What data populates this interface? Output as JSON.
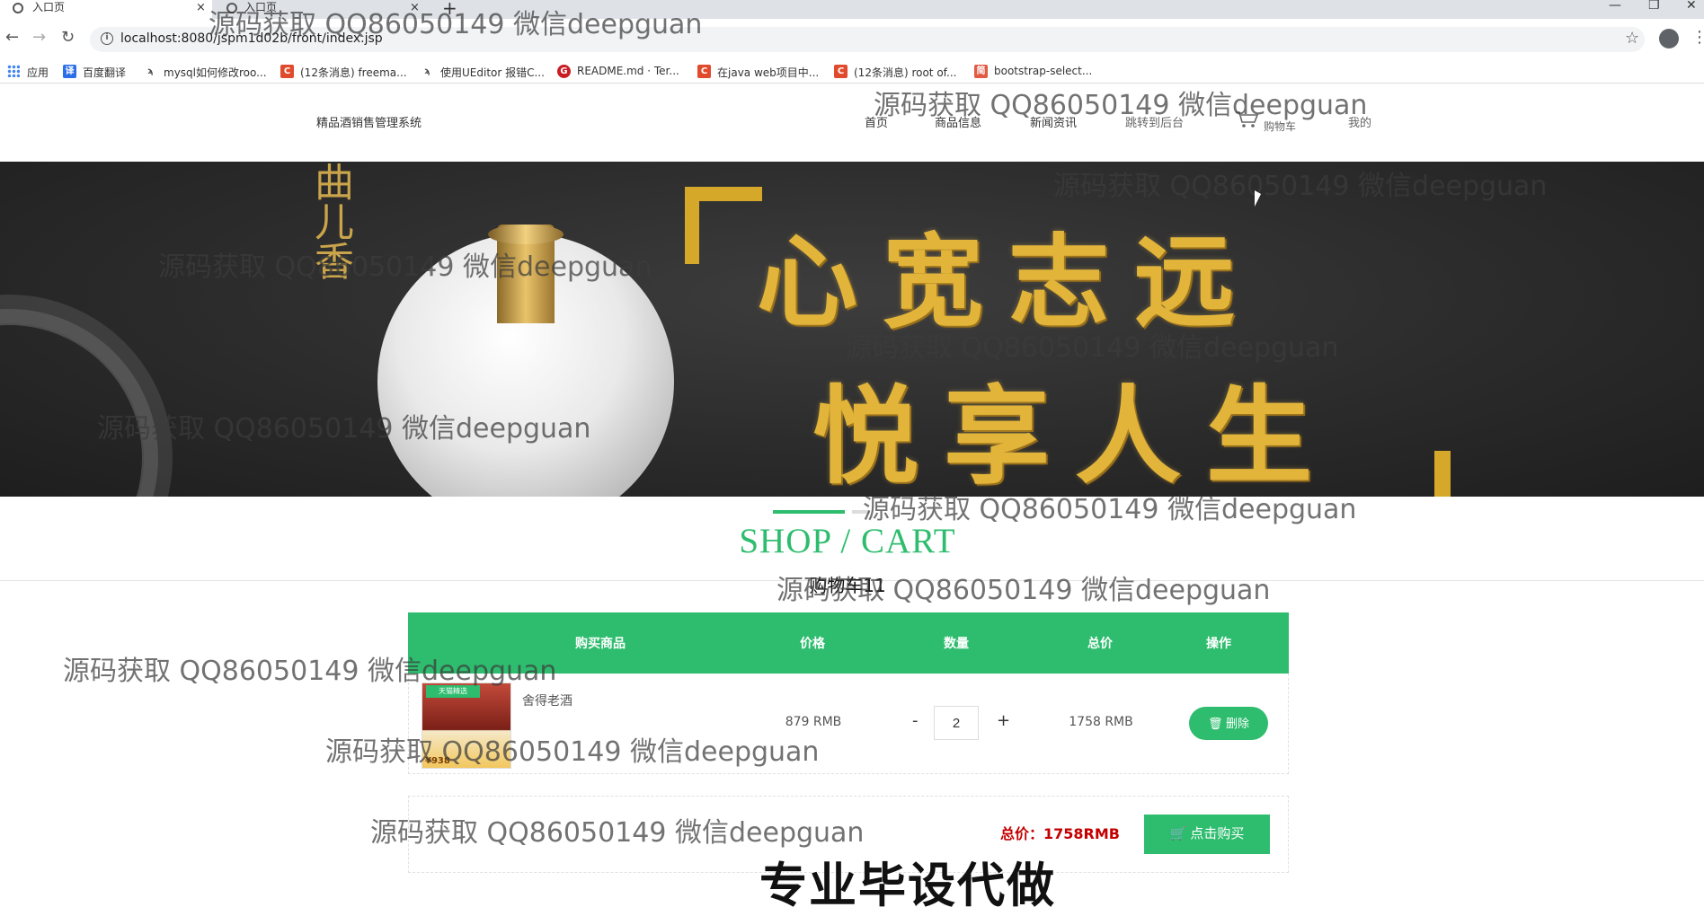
{
  "browser": {
    "tabs": [
      {
        "label": "入口页"
      },
      {
        "label": "入口页"
      }
    ],
    "tab_close": "×",
    "new_tab": "+",
    "window_controls": {
      "minimize": "—",
      "restore": "❐",
      "close": "✕"
    },
    "nav": {
      "back": "←",
      "forward": "→",
      "reload": "↻"
    },
    "url": "localhost:8080/jspm1d02b/front/index.jsp",
    "star": "☆",
    "menu": "⋮",
    "bookmarks": [
      {
        "label": "应用",
        "icon": "apps-grid-icon"
      },
      {
        "label": "百度翻译",
        "icon": "translate-icon",
        "icon_text": "译",
        "color": "#2a6ee8"
      },
      {
        "label": "mysql如何修改roo...",
        "icon": "link-icon",
        "icon_text": "ϡ",
        "color": "#444444"
      },
      {
        "label": "(12条消息) freema...",
        "icon": "csdn-icon",
        "icon_text": "C",
        "color": "#e04b2d"
      },
      {
        "label": "使用UEditor 报错C...",
        "icon": "link-icon",
        "icon_text": "ϡ",
        "color": "#444444"
      },
      {
        "label": "README.md · Ter...",
        "icon": "gitee-icon",
        "icon_text": "G",
        "color": "#c71d23"
      },
      {
        "label": "在java web项目中...",
        "icon": "csdn-icon",
        "icon_text": "C",
        "color": "#e04b2d"
      },
      {
        "label": "(12条消息) root of...",
        "icon": "csdn-icon",
        "icon_text": "C",
        "color": "#e04b2d"
      },
      {
        "label": "bootstrap-select...",
        "icon": "jianshu-icon",
        "icon_text": "简",
        "color": "#e05a44"
      }
    ]
  },
  "site": {
    "title": "精品酒销售管理系统",
    "nav": [
      {
        "label": "首页"
      },
      {
        "label": "商品信息"
      },
      {
        "label": "新闻资讯"
      },
      {
        "label": "跳转到后台"
      },
      {
        "label": "购物车"
      },
      {
        "label": "我的"
      }
    ]
  },
  "banner": {
    "brand": "曲儿香",
    "slogan_line1": "心宽志远",
    "slogan_line2": "悦享人生"
  },
  "section": {
    "title": "SHOP / CART",
    "cart_count": "购物车11"
  },
  "cart": {
    "headers": [
      "购买商品",
      "价格",
      "数量",
      "总价",
      "操作"
    ],
    "items": [
      {
        "name": "舍得老酒",
        "price": "879 RMB",
        "quantity": "2",
        "total": "1758 RMB",
        "thumb_tag": "天猫精选",
        "thumb_price": "¥938"
      }
    ],
    "minus": "-",
    "plus": "+",
    "delete_label": "🗑 删除",
    "total_label": "总价：1758RMB",
    "buy_label": "🛒 点击购买"
  },
  "promo": "专业毕设代做",
  "watermark": "源码获取 QQ86050149 微信deepguan",
  "colors": {
    "accent": "#2ebd6e",
    "price_red": "#c40000",
    "gold": "#e2b53a"
  }
}
